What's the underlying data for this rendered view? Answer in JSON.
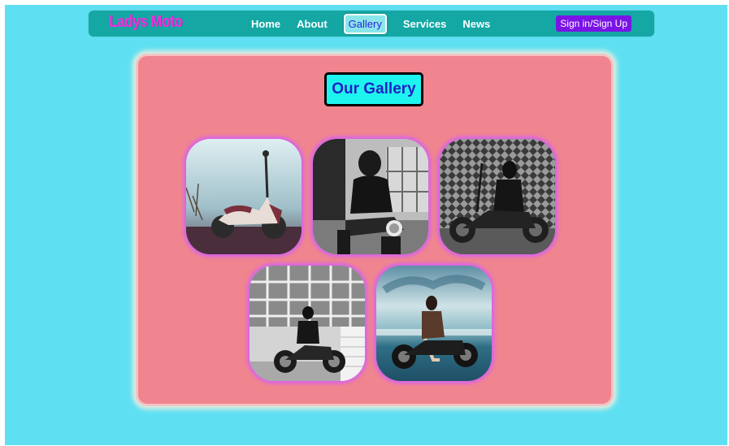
{
  "header": {
    "logo_text": "Ladys Moto",
    "nav": [
      {
        "label": "Home"
      },
      {
        "label": "About"
      },
      {
        "label": "Gallery",
        "active": true
      },
      {
        "label": "Services"
      },
      {
        "label": "News"
      }
    ],
    "sign_in_label": "Sign in/Sign Up"
  },
  "gallery": {
    "title": "Our Gallery",
    "photos": [
      {
        "icon": "scooter-photo"
      },
      {
        "icon": "woman-on-motorcycle-photo"
      },
      {
        "icon": "woman-with-motorcycle-brick-wall-photo"
      },
      {
        "icon": "motorcycle-by-window-photo"
      },
      {
        "icon": "woman-on-motorcycle-beach-photo"
      }
    ]
  },
  "colors": {
    "background": "#5fe0f2",
    "navbar": "#14a7a4",
    "logo": "#e23ad9",
    "sign_button": "#7a14e6",
    "panel": "#f0858f",
    "title_box": "#1ef4ee",
    "title_text": "#1f22c4",
    "photo_glow": "#d25aff"
  }
}
